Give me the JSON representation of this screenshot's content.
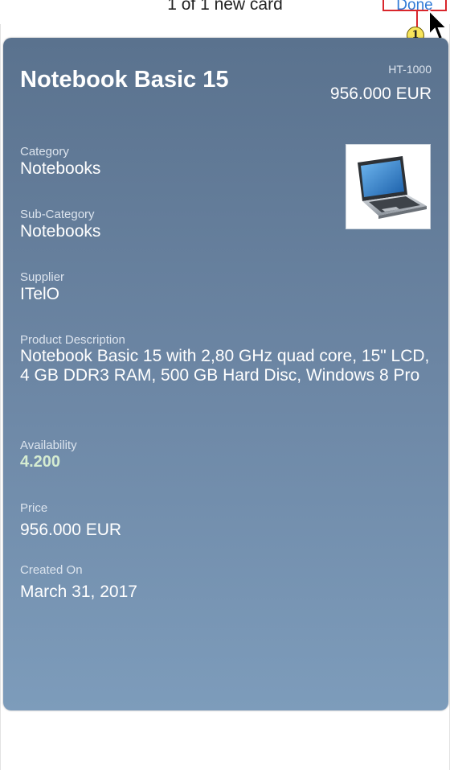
{
  "header": {
    "title": "1 of 1 new card",
    "done_label": "Done",
    "callout_number": "1"
  },
  "card": {
    "title": "Notebook Basic 15",
    "product_id": "HT-1000",
    "price_display": "956.000 EUR",
    "fields": [
      {
        "label": "Category",
        "value": "Notebooks"
      },
      {
        "label": "Sub-Category",
        "value": "Notebooks"
      },
      {
        "label": "Supplier",
        "value": "ITelO"
      },
      {
        "label": "Product Description",
        "value": "Notebook Basic 15 with 2,80 GHz quad core, 15\" LCD, 4 GB DDR3 RAM, 500 GB Hard Disc, Windows 8 Pro"
      },
      {
        "label": "Availability",
        "value": "4.200"
      },
      {
        "label": "Price",
        "value": "956.000 EUR"
      },
      {
        "label": "Created On",
        "value": "March 31, 2017"
      }
    ]
  },
  "colors": {
    "accent_blue": "#2f7ad6",
    "highlight_red": "#d9262c",
    "callout_yellow": "#f7e45b",
    "availability_green": "#d5ecd1"
  },
  "icons": {
    "product_image": "laptop-icon",
    "cursor": "mouse-pointer-icon"
  }
}
